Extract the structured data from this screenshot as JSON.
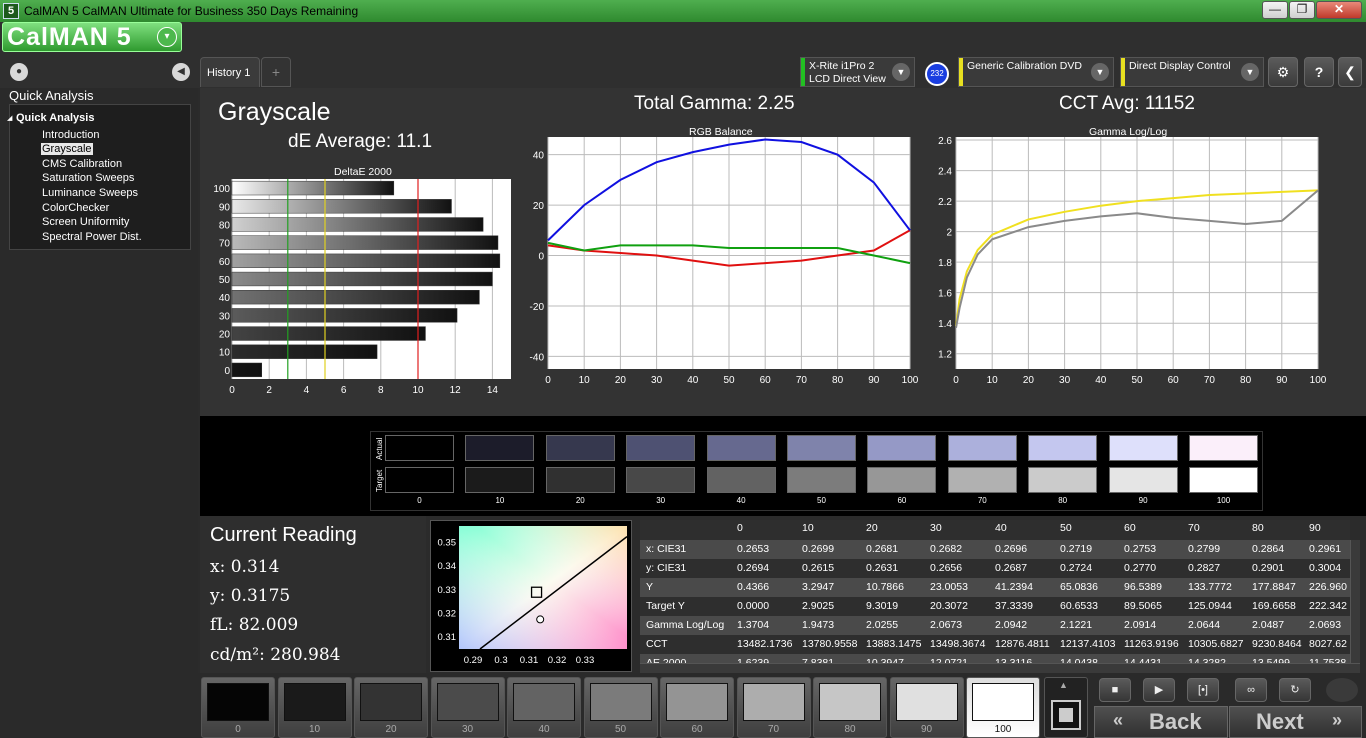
{
  "window": {
    "title": "CalMAN 5 CalMAN Ultimate for Business 350 Days Remaining",
    "min": "—",
    "max": "❐",
    "close": "✕"
  },
  "logo": {
    "text": "CalMAN 5",
    "dropdown": "▾"
  },
  "sidebar": {
    "heading": "Quick Analysis",
    "group": "Quick Analysis",
    "items": [
      {
        "label": "Introduction"
      },
      {
        "label": "Grayscale",
        "selected": true
      },
      {
        "label": "CMS Calibration"
      },
      {
        "label": "Saturation Sweeps"
      },
      {
        "label": "Luminance Sweeps"
      },
      {
        "label": "ColorChecker"
      },
      {
        "label": "Screen Uniformity"
      },
      {
        "label": "Spectral Power Dist."
      }
    ]
  },
  "tabs": {
    "history": "History 1",
    "add": "+"
  },
  "devices": {
    "meter": {
      "line1": "X-Rite i1Pro 2",
      "line2": "LCD Direct View",
      "color": "#22c022"
    },
    "badge": "232",
    "source": {
      "line1": "Generic Calibration DVD",
      "color": "#e8e020"
    },
    "display": {
      "line1": "Direct Display Control",
      "color": "#e8e020"
    }
  },
  "toolbar": {
    "settings_icon": "⚙",
    "help_label": "?",
    "collapse_icon": "❮"
  },
  "summary": {
    "section_title": "Grayscale",
    "de_average": "dE Average: 11.1",
    "total_gamma": "Total Gamma: 2.25",
    "cct_avg": "CCT Avg: 11152"
  },
  "chart_data": [
    {
      "type": "bar",
      "title": "DeltaE 2000",
      "categories": [
        "0",
        "10",
        "20",
        "30",
        "40",
        "50",
        "60",
        "70",
        "80",
        "90",
        "100"
      ],
      "values": [
        1.6,
        7.8,
        10.4,
        12.1,
        13.3,
        14.0,
        14.4,
        14.3,
        13.5,
        11.8,
        8.7
      ],
      "xlim": [
        0,
        15
      ],
      "xticks": [
        "0",
        "2",
        "4",
        "6",
        "8",
        "10",
        "12",
        "14"
      ],
      "reference_lines": [
        {
          "value": 3,
          "color": "#22a022"
        },
        {
          "value": 5,
          "color": "#e0d020"
        },
        {
          "value": 10,
          "color": "#e02020"
        }
      ]
    },
    {
      "type": "line",
      "title": "RGB Balance",
      "x": [
        0,
        10,
        20,
        30,
        40,
        50,
        60,
        70,
        80,
        90,
        100
      ],
      "ylim": [
        -45,
        47
      ],
      "yticks": [
        "40",
        "20",
        "0",
        "-20",
        "-40"
      ],
      "xticks": [
        "0",
        "10",
        "20",
        "30",
        "40",
        "50",
        "60",
        "70",
        "80",
        "90",
        "100"
      ],
      "series": [
        {
          "color": "#e01010",
          "values": [
            4,
            2,
            1,
            0,
            -2,
            -4,
            -3,
            -2,
            0,
            2,
            10
          ]
        },
        {
          "color": "#10a010",
          "values": [
            5,
            2,
            4,
            4,
            4,
            3,
            3,
            3,
            3,
            0,
            -3
          ]
        },
        {
          "color": "#1010e0",
          "values": [
            6,
            20,
            30,
            37,
            41,
            44,
            46,
            45,
            40,
            29,
            10
          ]
        }
      ]
    },
    {
      "type": "line",
      "title": "Gamma Log/Log",
      "x": [
        0,
        1,
        3,
        6,
        10,
        20,
        30,
        40,
        50,
        60,
        70,
        80,
        90,
        100
      ],
      "ylim": [
        1.1,
        2.62
      ],
      "yticks": [
        "2.6",
        "2.4",
        "2.2",
        "2",
        "1.8",
        "1.6",
        "1.4",
        "1.2"
      ],
      "xticks": [
        "0",
        "10",
        "20",
        "30",
        "40",
        "50",
        "60",
        "70",
        "80",
        "90",
        "100"
      ],
      "series": [
        {
          "color": "#f0e020",
          "values": [
            1.38,
            1.56,
            1.74,
            1.88,
            1.98,
            2.08,
            2.13,
            2.17,
            2.2,
            2.22,
            2.24,
            2.25,
            2.26,
            2.27
          ]
        },
        {
          "color": "#8a8a8a",
          "values": [
            1.37,
            1.5,
            1.7,
            1.85,
            1.95,
            2.03,
            2.07,
            2.1,
            2.12,
            2.09,
            2.07,
            2.05,
            2.07,
            2.27
          ]
        }
      ]
    },
    {
      "type": "scatter",
      "title": "",
      "xlim": [
        0.285,
        0.345
      ],
      "ylim": [
        0.305,
        0.357
      ],
      "xticks": [
        "0.29",
        "0.3",
        "0.31",
        "0.32",
        "0.33"
      ],
      "yticks": [
        "0.35",
        "0.34",
        "0.33",
        "0.32",
        "0.31"
      ],
      "target": {
        "x": 0.3127,
        "y": 0.329
      },
      "measured": {
        "x": 0.314,
        "y": 0.3175
      }
    }
  ],
  "swatches": {
    "actual_label": "Actual",
    "target_label": "Target",
    "levels": [
      "0",
      "10",
      "20",
      "30",
      "40",
      "50",
      "60",
      "70",
      "80",
      "90",
      "100"
    ],
    "actual_colors": [
      "#000000",
      "#1c1c2a",
      "#36384e",
      "#4e5172",
      "#66698f",
      "#7f83ab",
      "#9599c6",
      "#acb0dc",
      "#c4c7ef",
      "#dee0fb",
      "#fbeffa"
    ],
    "target_colors": [
      "#000000",
      "#1b1b1b",
      "#303030",
      "#484848",
      "#626262",
      "#7c7c7c",
      "#979797",
      "#b1b1b1",
      "#cbcbcb",
      "#e5e5e5",
      "#ffffff"
    ]
  },
  "reading": {
    "title": "Current Reading",
    "x": "x: 0.314",
    "y": "y: 0.3175",
    "fl": "fL: 82.009",
    "cd": "cd/m²: 280.984"
  },
  "table": {
    "columns": [
      "0",
      "10",
      "20",
      "30",
      "40",
      "50",
      "60",
      "70",
      "80",
      "90"
    ],
    "rows": [
      {
        "label": "x: CIE31",
        "values": [
          "0.2653",
          "0.2699",
          "0.2681",
          "0.2682",
          "0.2696",
          "0.2719",
          "0.2753",
          "0.2799",
          "0.2864",
          "0.2961"
        ]
      },
      {
        "label": "y: CIE31",
        "values": [
          "0.2694",
          "0.2615",
          "0.2631",
          "0.2656",
          "0.2687",
          "0.2724",
          "0.2770",
          "0.2827",
          "0.2901",
          "0.3004"
        ]
      },
      {
        "label": "Y",
        "values": [
          "0.4366",
          "3.2947",
          "10.7866",
          "23.0053",
          "41.2394",
          "65.0836",
          "96.5389",
          "133.7772",
          "177.8847",
          "226.960"
        ]
      },
      {
        "label": "Target Y",
        "values": [
          "0.0000",
          "2.9025",
          "9.3019",
          "20.3072",
          "37.3339",
          "60.6533",
          "89.5065",
          "125.0944",
          "169.6658",
          "222.342"
        ]
      },
      {
        "label": "Gamma Log/Log",
        "values": [
          "1.3704",
          "1.9473",
          "2.0255",
          "2.0673",
          "2.0942",
          "2.1221",
          "2.0914",
          "2.0644",
          "2.0487",
          "2.0693"
        ]
      },
      {
        "label": "CCT",
        "values": [
          "13482.1736",
          "13780.9558",
          "13883.1475",
          "13498.3674",
          "12876.4811",
          "12137.4103",
          "11263.9196",
          "10305.6827",
          "9230.8464",
          "8027.62"
        ]
      },
      {
        "label": "ΔE 2000",
        "values": [
          "1.6239",
          "7.8381",
          "10.3947",
          "12.0721",
          "13.3116",
          "14.0438",
          "14.4431",
          "14.3282",
          "13.5499",
          "11.7538"
        ]
      }
    ]
  },
  "bottom": {
    "levels": [
      "0",
      "10",
      "20",
      "30",
      "40",
      "50",
      "60",
      "70",
      "80",
      "90",
      "100"
    ],
    "face_colors": [
      "#050505",
      "#1a1a1a",
      "#333333",
      "#4b4b4b",
      "#636363",
      "#7b7b7b",
      "#949494",
      "#adadad",
      "#c6c6c6",
      "#e0e0e0",
      "#ffffff"
    ],
    "selected": "100",
    "back_label": "Back",
    "next_label": "Next"
  }
}
